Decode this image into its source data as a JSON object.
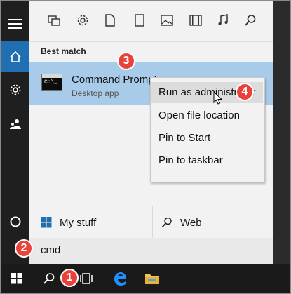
{
  "left_rail": {
    "items": [
      {
        "name": "hamburger-icon"
      },
      {
        "name": "home-icon"
      },
      {
        "name": "gear-icon"
      },
      {
        "name": "people-icon"
      },
      {
        "name": "cortana-icon"
      }
    ]
  },
  "filters": [
    {
      "name": "apps-filter-icon"
    },
    {
      "name": "settings-filter-icon"
    },
    {
      "name": "documents-filter-icon"
    },
    {
      "name": "folders-filter-icon"
    },
    {
      "name": "photos-filter-icon"
    },
    {
      "name": "videos-filter-icon"
    },
    {
      "name": "music-filter-icon"
    },
    {
      "name": "web-filter-icon"
    }
  ],
  "best_match": {
    "heading": "Best match",
    "title": "Command Prompt",
    "subtitle": "Desktop app",
    "icon_text": "C:\\_"
  },
  "context_menu": {
    "items": [
      {
        "label": "Run as administrator"
      },
      {
        "label": "Open file location"
      },
      {
        "label": "Pin to Start"
      },
      {
        "label": "Pin to taskbar"
      }
    ]
  },
  "bottom_row": {
    "my_stuff": "My stuff",
    "web": "Web"
  },
  "search": {
    "query": "cmd"
  },
  "callouts": [
    "1",
    "2",
    "3",
    "4"
  ],
  "colors": {
    "accent": "#1f6fb2",
    "highlight": "#a8cbe9",
    "callout": "#e8423b",
    "edge": "#1e90ff",
    "folder": "#f2c14e"
  }
}
